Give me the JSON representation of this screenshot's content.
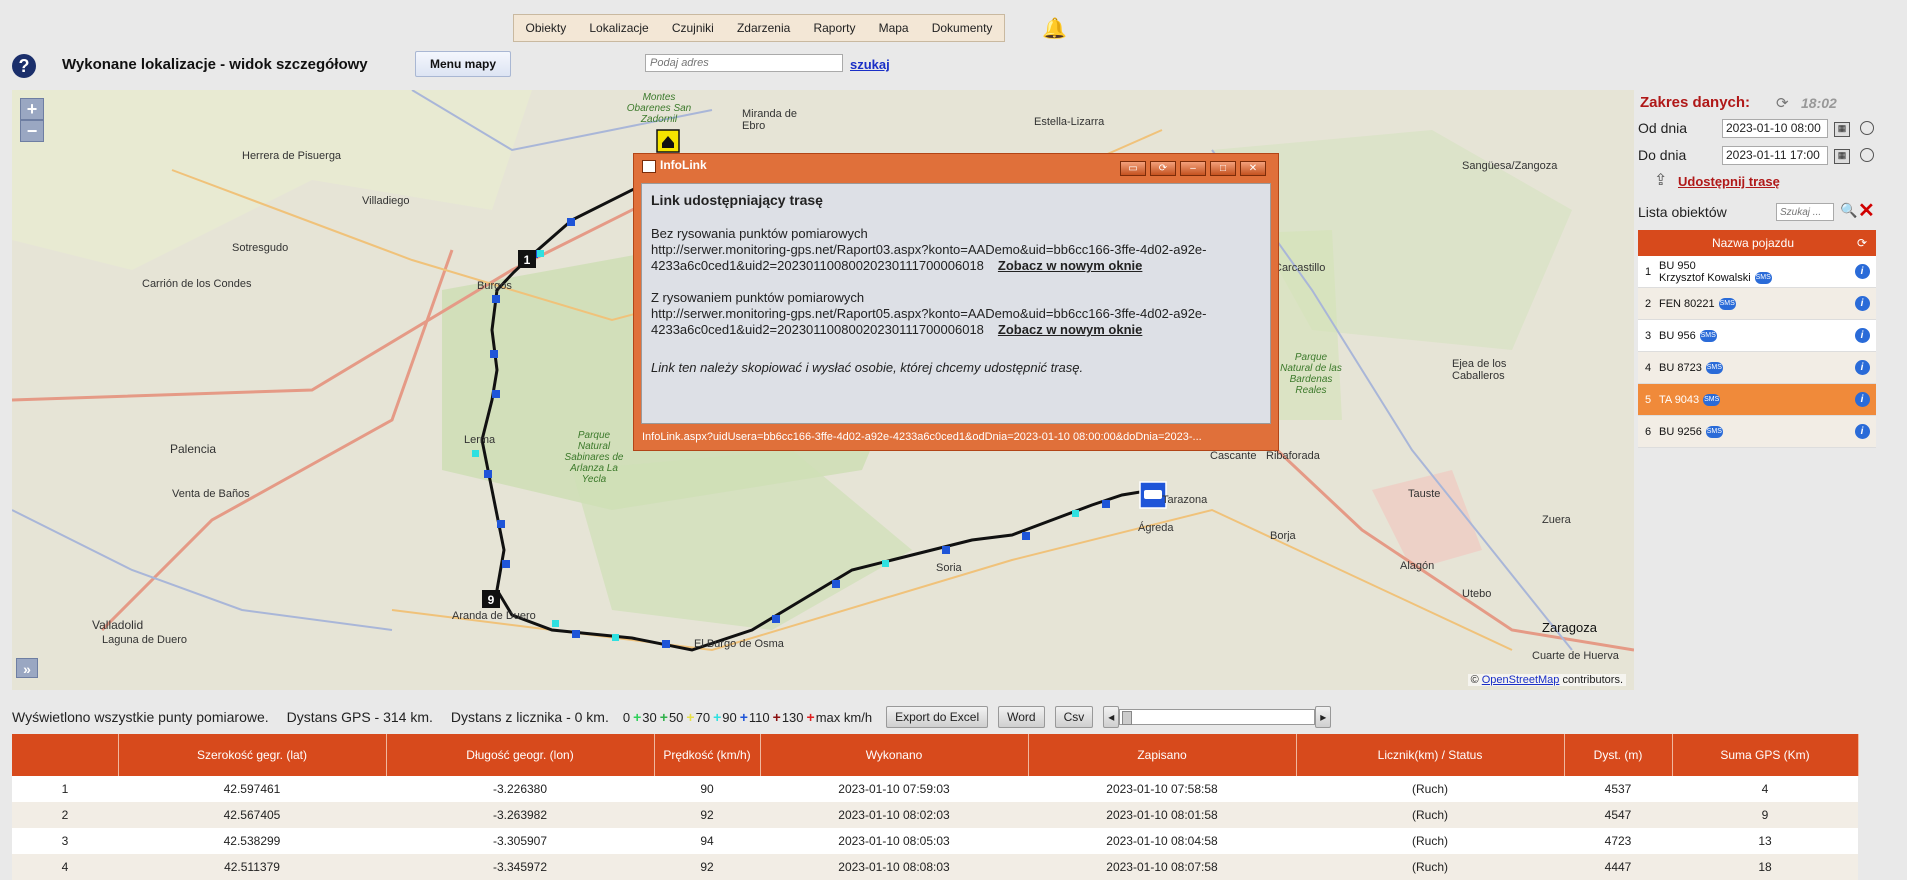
{
  "nav": {
    "items": [
      "Obiekty",
      "Lokalizacje",
      "Czujniki",
      "Zdarzenia",
      "Raporty",
      "Mapa",
      "Dokumenty"
    ]
  },
  "header": {
    "help": "?",
    "title": "Wykonane lokalizacje - widok szczegółowy",
    "menu_map_label": "Menu mapy",
    "address_placeholder": "Podaj adres",
    "search_label": "szukaj"
  },
  "map": {
    "zoom_in": "+",
    "zoom_out": "−",
    "expand": "»",
    "attribution_prefix": "©",
    "attribution_link": "OpenStreetMap",
    "attribution_suffix": "contributors.",
    "marker_labels": [
      "1",
      "9"
    ],
    "places": [
      {
        "name": "Herrera de Pisuerga"
      },
      {
        "name": "Villadiego"
      },
      {
        "name": "Carrión de los Condes"
      },
      {
        "name": "Sotresgudo"
      },
      {
        "name": "Burgos"
      },
      {
        "name": "Palencia"
      },
      {
        "name": "Venta de Baños"
      },
      {
        "name": "Valladolid"
      },
      {
        "name": "Laguna de Duero"
      },
      {
        "name": "Lerma"
      },
      {
        "name": "Aranda de Duero"
      },
      {
        "name": "El Burgo de Osma"
      },
      {
        "name": "Soria"
      },
      {
        "name": "Ágreda"
      },
      {
        "name": "Tarazona"
      },
      {
        "name": "Borja"
      },
      {
        "name": "Zaragoza"
      },
      {
        "name": "Alagón"
      },
      {
        "name": "Utebo"
      },
      {
        "name": "Cuarte de Huerva"
      },
      {
        "name": "Estella-Lizarra"
      },
      {
        "name": "Sangüesa/Zangoza"
      },
      {
        "name": "Carcastillo"
      },
      {
        "name": "Ejea de los Caballeros"
      },
      {
        "name": "Tauste"
      },
      {
        "name": "Zuera"
      },
      {
        "name": "Cascante"
      },
      {
        "name": "Ribaforada"
      },
      {
        "name": "Miranda de Ebro"
      },
      {
        "name": "Montes Obarenes San Zadornil"
      },
      {
        "name": "Parque Natural Sabinares de Arlanza La Yecla"
      },
      {
        "name": "Parque Natural de las Bardenas Reales"
      }
    ]
  },
  "infolink": {
    "title": "InfoLink",
    "heading": "Link udostępniający trasę",
    "without_label": "Bez rysowania punktów pomiarowych",
    "without_url_1": "http://serwer.monitoring-gps.net/Raport03.aspx?konto=AADemo&uid=bb6cc166-3ffe-4d02-a92e-",
    "without_url_2": "4233a6c0ced1&uid2=20230110080020230111700006018",
    "with_label": "Z rysowaniem punktów pomiarowych",
    "with_url_1": "http://serwer.monitoring-gps.net/Raport05.aspx?konto=AADemo&uid=bb6cc166-3ffe-4d02-a92e-",
    "with_url_2": "4233a6c0ced1&uid2=20230110080020230111700006018",
    "open_new": "Zobacz w nowym oknie",
    "note": "Link ten należy skopiować i wysłać osobie, której chcemy udostępnić trasę.",
    "status": "InfoLink.aspx?uidUsera=bb6cc166-3ffe-4d02-a92e-4233a6c0ced1&odDnia=2023-01-10 08:00:00&doDnia=2023-..."
  },
  "panel": {
    "zakres_label": "Zakres danych:",
    "time": "18:02",
    "od_label": "Od dnia",
    "od_value": "2023-01-10 08:00",
    "do_label": "Do dnia",
    "do_value": "2023-01-11 17:00",
    "share_label": "Udostępnij trasę",
    "lista_label": "Lista obiektów",
    "lista_placeholder": "Szukaj ...",
    "vehicle_header": "Nazwa pojazdu",
    "sms": "SMS",
    "vehicles": [
      {
        "n": "1",
        "name": "BU 950",
        "driver": "Krzysztof Kowalski"
      },
      {
        "n": "2",
        "name": "FEN 80221",
        "driver": ""
      },
      {
        "n": "3",
        "name": "BU 956",
        "driver": ""
      },
      {
        "n": "4",
        "name": "BU 8723",
        "driver": ""
      },
      {
        "n": "5",
        "name": "TA 9043",
        "driver": ""
      },
      {
        "n": "6",
        "name": "BU 9256",
        "driver": ""
      }
    ]
  },
  "stats": {
    "shown": "Wyświetlono wszystkie punty pomiarowe.",
    "gps": "Dystans GPS - 314 km.",
    "counter": "Dystans z licznika - 0 km.",
    "speeds": [
      "0",
      "30",
      "50",
      "70",
      "90",
      "110",
      "130",
      "max km/h"
    ],
    "export_excel": "Export do Excel",
    "word": "Word",
    "csv": "Csv"
  },
  "table": {
    "headers": [
      "",
      "Szerokość gegr. (lat)",
      "Długość geogr. (lon)",
      "Prędkość (km/h)",
      "Wykonano",
      "Zapisano",
      "Licznik(km) / Status",
      "Dyst. (m)",
      "Suma GPS (Km)"
    ],
    "rows": [
      [
        "1",
        "42.597461",
        "-3.226380",
        "90",
        "2023-01-10 07:59:03",
        "2023-01-10 07:58:58",
        "(Ruch)",
        "4537",
        "4"
      ],
      [
        "2",
        "42.567405",
        "-3.263982",
        "92",
        "2023-01-10 08:02:03",
        "2023-01-10 08:01:58",
        "(Ruch)",
        "4547",
        "9"
      ],
      [
        "3",
        "42.538299",
        "-3.305907",
        "94",
        "2023-01-10 08:05:03",
        "2023-01-10 08:04:58",
        "(Ruch)",
        "4723",
        "13"
      ],
      [
        "4",
        "42.511379",
        "-3.345972",
        "92",
        "2023-01-10 08:08:03",
        "2023-01-10 08:07:58",
        "(Ruch)",
        "4447",
        "18"
      ]
    ]
  }
}
